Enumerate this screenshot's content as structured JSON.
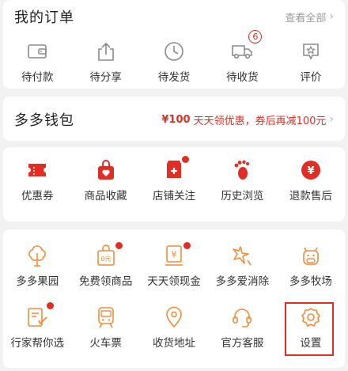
{
  "colors": {
    "accent": "#e02e24",
    "line_icon": "#f28c3a",
    "background": "#f2f2f2"
  },
  "orders": {
    "title": "我的订单",
    "view_all": "查看全部",
    "items": [
      {
        "label": "待付款",
        "icon": "wallet-icon"
      },
      {
        "label": "待分享",
        "icon": "share-icon"
      },
      {
        "label": "待发货",
        "icon": "clock-icon"
      },
      {
        "label": "待收货",
        "icon": "truck-icon",
        "badge": "6"
      },
      {
        "label": "评价",
        "icon": "review-star-icon"
      }
    ]
  },
  "wallet": {
    "title": "多多钱包",
    "promo_amount": "¥100",
    "promo_text": "天天领优惠，券后再减100元"
  },
  "features": [
    {
      "label": "优惠券",
      "icon": "coupon-icon"
    },
    {
      "label": "商品收藏",
      "icon": "favorite-bag-icon"
    },
    {
      "label": "店铺关注",
      "icon": "store-follow-icon",
      "dot": true
    },
    {
      "label": "历史浏览",
      "icon": "footprint-icon"
    },
    {
      "label": "退款售后",
      "icon": "refund-icon"
    }
  ],
  "services": {
    "row1": [
      {
        "label": "多多果园",
        "icon": "tree-icon"
      },
      {
        "label": "免费领商品",
        "icon": "free-goods-icon",
        "dot": true
      },
      {
        "label": "天天领现金",
        "icon": "cash-icon",
        "dot": true
      },
      {
        "label": "多多爱消除",
        "icon": "sparkle-icon"
      },
      {
        "label": "多多牧场",
        "icon": "cow-icon"
      }
    ],
    "row2": [
      {
        "label": "行家帮你选",
        "icon": "expert-pick-icon",
        "dot": true
      },
      {
        "label": "火车票",
        "icon": "train-icon"
      },
      {
        "label": "收货地址",
        "icon": "location-icon"
      },
      {
        "label": "官方客服",
        "icon": "headset-icon"
      },
      {
        "label": "设置",
        "icon": "settings-icon"
      }
    ]
  }
}
